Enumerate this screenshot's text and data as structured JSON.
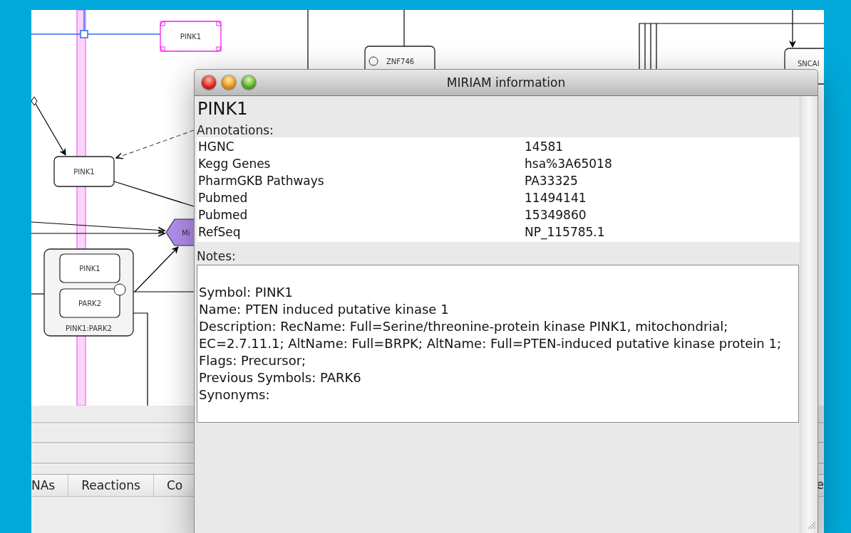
{
  "diagram": {
    "nodes": [
      {
        "kind": "protein",
        "label": "PINK1",
        "selected": true
      },
      {
        "kind": "protein",
        "label": "ZNF746",
        "selected": false
      },
      {
        "kind": "protein",
        "label": "SNCAI",
        "selected": false
      },
      {
        "kind": "protein",
        "label": "PINK1",
        "selected": false
      },
      {
        "kind": "phenotype",
        "label": "Mi",
        "selected": false
      },
      {
        "kind": "complex",
        "label": "PINK1:PARK2",
        "selected": false,
        "children": [
          {
            "label": "PINK1"
          },
          {
            "label": "PARK2"
          }
        ]
      }
    ]
  },
  "tabs": [
    {
      "label": "NAs",
      "selected": false
    },
    {
      "label": "Reactions",
      "selected": false
    },
    {
      "label": "Co",
      "selected": false
    }
  ],
  "right_tab_fragment": "e",
  "dialog": {
    "title": "MIRIAM information",
    "heading": "PINK1",
    "annotations_label": "Annotations:",
    "annotations": [
      {
        "resource": "HGNC",
        "id": "14581"
      },
      {
        "resource": "Kegg Genes",
        "id": "hsa%3A65018"
      },
      {
        "resource": "PharmGKB Pathways",
        "id": "PA33325"
      },
      {
        "resource": "Pubmed",
        "id": "11494141"
      },
      {
        "resource": "Pubmed",
        "id": "15349860"
      },
      {
        "resource": "RefSeq",
        "id": "NP_115785.1"
      }
    ],
    "notes_label": "Notes:",
    "notes": [
      "Symbol: PINK1",
      "Name: PTEN induced putative kinase 1",
      "Description: RecName: Full=Serine/threonine-protein kinase PINK1, mitochondrial; EC=2.7.11.1; AltName: Full=BRPK; AltName: Full=PTEN-induced putative kinase protein 1; Flags: Precursor;",
      "Previous Symbols: PARK6",
      "Synonyms:"
    ]
  }
}
